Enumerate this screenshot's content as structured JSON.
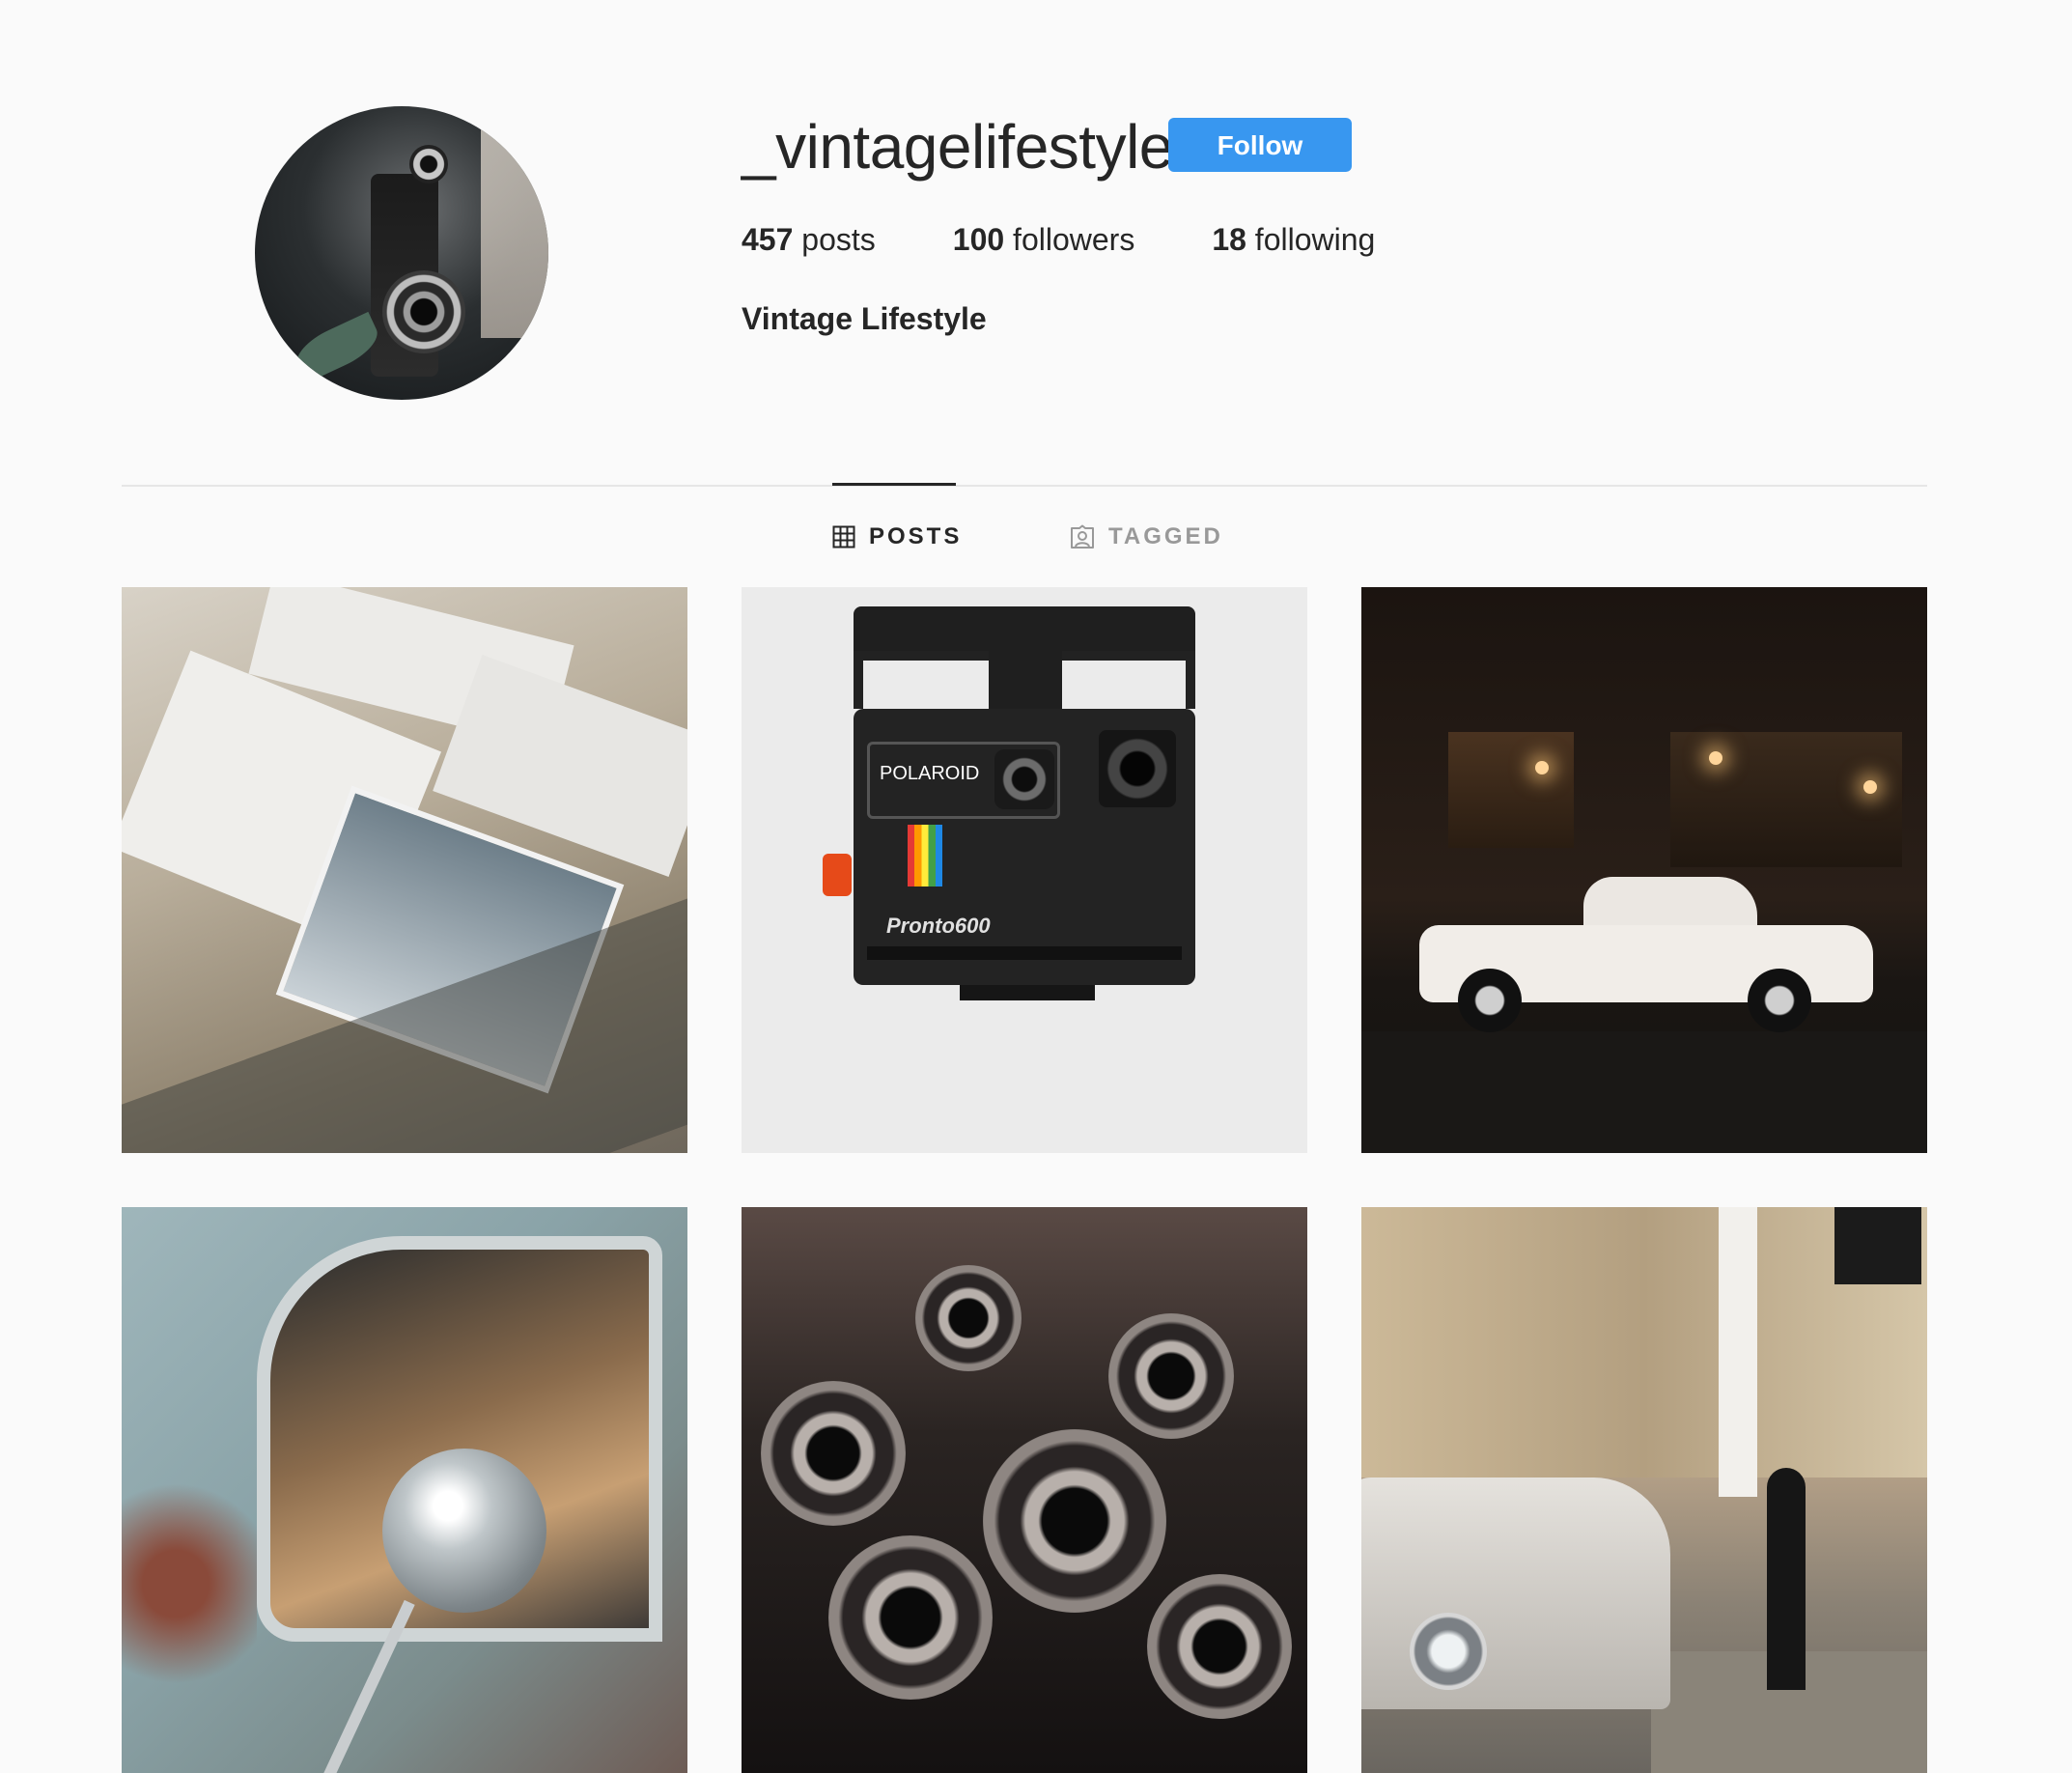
{
  "profile": {
    "username": "_vintagelifestyle",
    "follow_label": "Follow",
    "full_name": "Vintage Lifestyle",
    "stats": {
      "posts_count": "457",
      "posts_label": "posts",
      "followers_count": "100",
      "followers_label": "followers",
      "following_count": "18",
      "following_label": "following"
    }
  },
  "tabs": [
    {
      "label": "POSTS",
      "icon": "grid-icon",
      "active": true
    },
    {
      "label": "TAGGED",
      "icon": "tagged-user-icon",
      "active": false
    }
  ],
  "posts": [
    {
      "subject": "letters-and-photos"
    },
    {
      "subject": "polaroid-camera",
      "brand_text": "POLAROID",
      "model_text": "Pronto600"
    },
    {
      "subject": "white-car-at-night"
    },
    {
      "subject": "vintage-car-mirror"
    },
    {
      "subject": "old-cameras"
    },
    {
      "subject": "old-car-on-street"
    }
  ],
  "colors": {
    "accent": "#3897f0",
    "background": "#fafafa",
    "text": "#262626",
    "muted": "#999999"
  }
}
